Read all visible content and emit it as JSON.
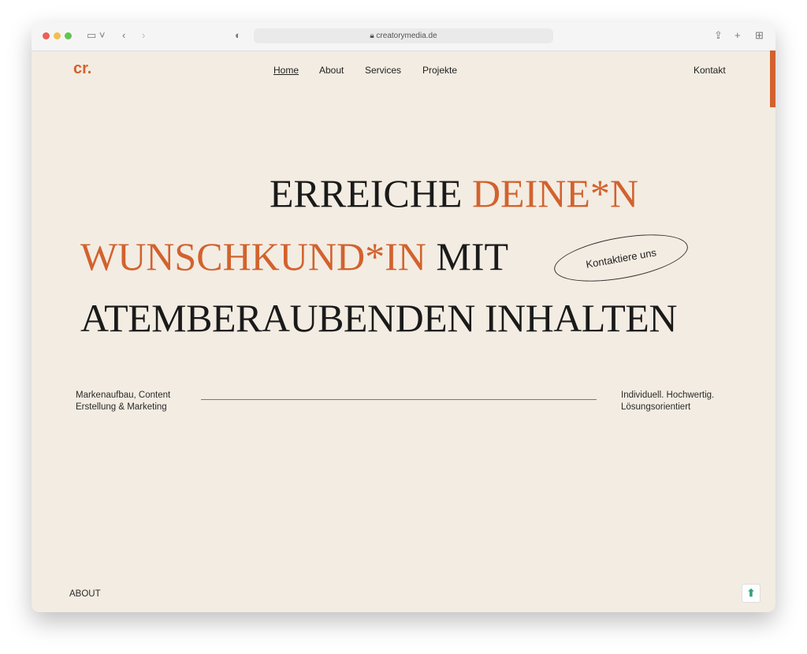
{
  "browser": {
    "url": "creatorymedia.de"
  },
  "nav": {
    "logo": "cr.",
    "items": [
      "Home",
      "About",
      "Services",
      "Projekte"
    ],
    "contact": "Kontakt"
  },
  "hero": {
    "line1a": "ERREICHE",
    "line1b": "DEINE*N",
    "line2a": "WUNSCHKUND*IN",
    "line2b": "MIT",
    "line3": "ATEMBERAUBENDEN INHALTEN",
    "cta": "Kontaktiere uns"
  },
  "left_text": [
    "Markenaufbau, Content",
    "Erstellung & Marketing"
  ],
  "right_text": [
    "Individuell. Hochwertig.",
    "Lösungsorientiert"
  ],
  "footer_label": "ABOUT",
  "colors": {
    "accent": "#d2622e",
    "bg": "#f3ece2"
  }
}
